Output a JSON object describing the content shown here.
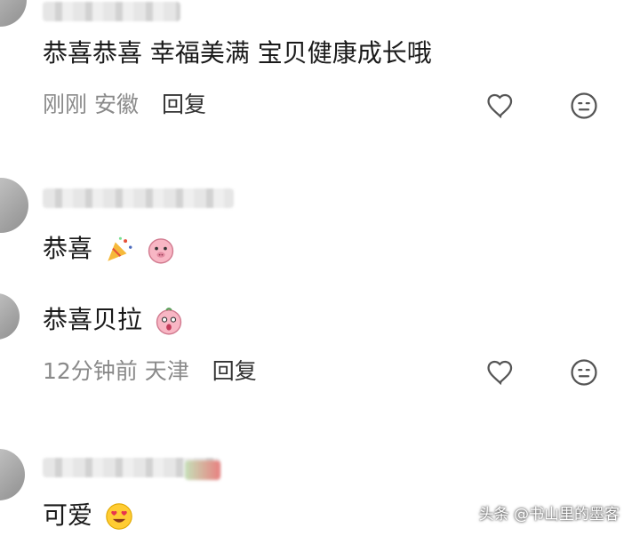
{
  "comments": [
    {
      "text": "恭喜恭喜 幸福美满 宝贝健康成长哦",
      "time": "刚刚",
      "location": "安徽",
      "reply": "回复"
    },
    {
      "text": "恭喜",
      "emoji": [
        "party-popper-emoji",
        "pig-face-emoji"
      ]
    },
    {
      "text": "恭喜贝拉",
      "emoji": [
        "pig-face-emoji"
      ],
      "time": "12分钟前",
      "location": "天津",
      "reply": "回复"
    },
    {
      "text": "可爱",
      "emoji": [
        "heart-eyes-emoji"
      ]
    }
  ],
  "watermark": "头条 @书山里的墨客",
  "colors": {
    "text": "#1a1a1a",
    "meta": "#8a8a8a",
    "icon": "#555555"
  },
  "icons": [
    "heart-icon",
    "smiley-icon"
  ]
}
